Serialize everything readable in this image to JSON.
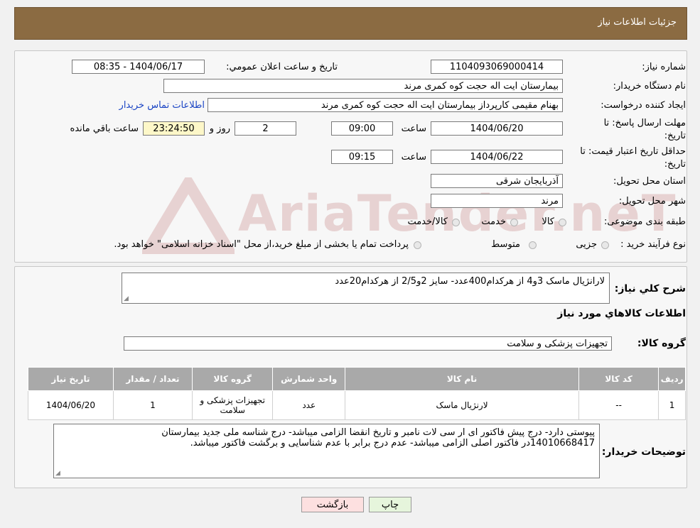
{
  "header": {
    "title": "جزئیات اطلاعات نیاز"
  },
  "fields": {
    "need_number_label": "شماره نیاز:",
    "need_number": "1104093069000414",
    "announce_label": "تاریخ و ساعت اعلان عمومي:",
    "announce_value": "1404/06/17 - 08:35",
    "buyer_org_label": "نام دستگاه خریدار:",
    "buyer_org": "بیمارستان ایت اله حجت کوه کمری مرند",
    "requester_label": "ایجاد کننده درخواست:",
    "requester": "بهنام مقیمی کارپرداز بیمارستان ایت اله حجت کوه کمری مرند",
    "contact_link": "اطلاعات تماس خریدار",
    "deadline_label_1": "مهلت ارسال پاسخ: تا",
    "deadline_label_2": "تاریخ:",
    "deadline_date": "1404/06/20",
    "time_label": "ساعت",
    "deadline_time": "09:00",
    "days_value": "2",
    "days_label": "روز و",
    "remaining_time": "23:24:50",
    "remaining_label": "ساعت باقي مانده",
    "validity_label_1": "حداقل تاریخ اعتبار قیمت: تا",
    "validity_label_2": "تاریخ:",
    "validity_date": "1404/06/22",
    "validity_time": "09:15",
    "province_label": "استان محل تحویل:",
    "province": "آذربایجان شرقی",
    "city_label": "شهر محل تحویل:",
    "city": "مرند",
    "category_label": "طبقه بندی موضوعی:",
    "category_options": [
      "کالا",
      "خدمت",
      "کالا/خدمت"
    ],
    "process_label": "نوع فرآیند خرید :",
    "process_options": [
      "جزیی",
      "متوسط"
    ],
    "process_note": "پرداخت تمام یا بخشی از مبلغ خرید،از محل \"اسناد خزانه اسلامی\" خواهد بود."
  },
  "summary": {
    "desc_label": "شرح کلي نیاز:",
    "desc_value": "لارانژیال ماسک 3و4 از هرکدام400عدد- سایز 2و2/5 از هرکدام20عدد",
    "items_title": "اطلاعات کالاهاي مورد نیاز",
    "group_label": "گروه کالا:",
    "group_value": "تجهیزات پزشکی و سلامت"
  },
  "table": {
    "headers": [
      "ردیف",
      "کد کالا",
      "نام کالا",
      "واحد شمارش",
      "گروه کالا",
      "تعداد / مقدار",
      "تاریخ نیاز"
    ],
    "rows": [
      [
        "1",
        "--",
        "لارنژیال ماسک",
        "عدد",
        "تجهیزات پزشکی و سلامت",
        "1",
        "1404/06/20"
      ]
    ]
  },
  "notes": {
    "label": "توضیحات خریدار:",
    "line1": "پیوستی دارد- درج پیش فاکتور ای ار سی لات نامبر و تاریخ انقضا الزامی میباشد- درج شناسه ملی  جدید بیمارستان",
    "line2": "14010668417در فاکتور اصلی الزامی میباشد- عدم درج برابر با عدم شناسایی و برگشت فاکتور میباشد."
  },
  "buttons": {
    "print": "چاپ",
    "back": "بازگشت"
  },
  "colors": {
    "header_bg": "#8b6b42",
    "link": "#1a44c4",
    "table_header": "#a9a9a9"
  }
}
